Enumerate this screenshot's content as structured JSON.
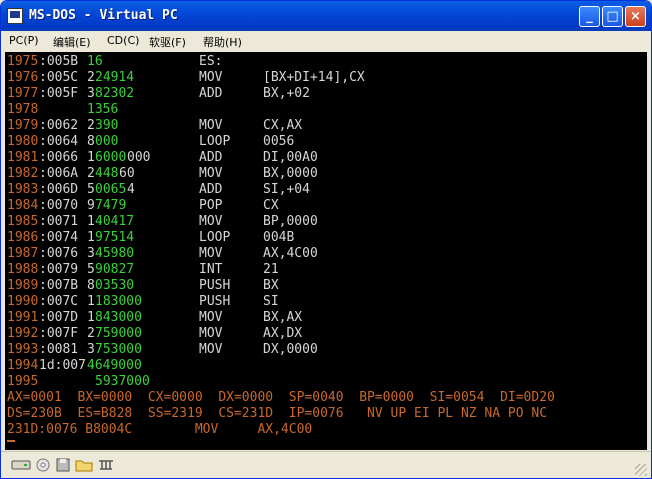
{
  "window": {
    "title": "MS-DOS - Virtual PC",
    "minimize_glyph": "_",
    "maximize_glyph": "□",
    "close_glyph": "×"
  },
  "menu": [
    {
      "label": "PC(P)"
    },
    {
      "label": "编辑(E)"
    },
    {
      "label": "CD(C)"
    },
    {
      "label": "软驱(F)"
    },
    {
      "label": "帮助(H)"
    }
  ],
  "listing": [
    {
      "n": "1975",
      "addr": ":005B",
      "ga": "",
      "val": "16",
      "vb": "",
      "mn": "ES:",
      "op": ""
    },
    {
      "n": "1976",
      "addr": ":005C",
      "ga": "2",
      "val": "24914",
      "vb": "",
      "mn": "MOV",
      "op": "[BX+DI+14],CX"
    },
    {
      "n": "1977",
      "addr": ":005F",
      "ga": "3",
      "val": "82302",
      "vb": "",
      "mn": "ADD",
      "op": "BX,+02"
    },
    {
      "n": "1978",
      "addr": "",
      "ga": "",
      "val": "1356",
      "vb": "",
      "mn": "",
      "op": ""
    },
    {
      "n": "1979",
      "addr": ":0062",
      "ga": "2",
      "val": "390",
      "vb": "",
      "mn": "MOV",
      "op": "CX,AX"
    },
    {
      "n": "1980",
      "addr": ":0064",
      "ga": "8",
      "val": "000",
      "vb": "",
      "mn": "LOOP",
      "op": "0056"
    },
    {
      "n": "1981",
      "addr": ":0066",
      "ga": "1",
      "val": "6000",
      "vb": "000",
      "mn": "ADD",
      "op": "DI,00A0"
    },
    {
      "n": "1982",
      "addr": ":006A",
      "ga": "2",
      "val": "448",
      "vb": "60",
      "mn": "MOV",
      "op": "BX,0000"
    },
    {
      "n": "1983",
      "addr": ":006D",
      "ga": "5",
      "val": "0065",
      "vb": "4",
      "mn": "ADD",
      "op": "SI,+04"
    },
    {
      "n": "1984",
      "addr": ":0070",
      "ga": "9",
      "val": "7479",
      "vb": "",
      "mn": "POP",
      "op": "CX"
    },
    {
      "n": "1985",
      "addr": ":0071",
      "ga": "1",
      "val": "40417",
      "vb": "",
      "mn": "MOV",
      "op": "BP,0000"
    },
    {
      "n": "1986",
      "addr": ":0074",
      "ga": "1",
      "val": "97514",
      "vb": "",
      "mn": "LOOP",
      "op": "004B"
    },
    {
      "n": "1987",
      "addr": ":0076",
      "ga": "3",
      "val": "45980",
      "vb": "",
      "mn": "MOV",
      "op": "AX,4C00"
    },
    {
      "n": "1988",
      "addr": ":0079",
      "ga": "5",
      "val": "90827",
      "vb": "",
      "mn": "INT",
      "op": "21"
    },
    {
      "n": "1989",
      "addr": ":007B",
      "ga": "8",
      "val": "03530",
      "vb": "",
      "mn": "PUSH",
      "op": "BX"
    },
    {
      "n": "1990",
      "addr": ":007C",
      "ga": "1",
      "val": "183000",
      "vb": "",
      "mn": "PUSH",
      "op": "SI"
    },
    {
      "n": "1991",
      "addr": ":007D",
      "ga": "1",
      "val": "843000",
      "vb": "",
      "mn": "MOV",
      "op": "BX,AX"
    },
    {
      "n": "1992",
      "addr": ":007F",
      "ga": "2",
      "val": "759000",
      "vb": "",
      "mn": "MOV",
      "op": "AX,DX"
    },
    {
      "n": "1993",
      "addr": ":0081",
      "ga": "3",
      "val": "753000",
      "vb": "",
      "mn": "MOV",
      "op": "DX,0000"
    }
  ],
  "row1994": {
    "n": "1994",
    "mid": "1d:007",
    "val": "4649000"
  },
  "row1995": {
    "n": "1995",
    "val": "5937000"
  },
  "registers": {
    "line1": "AX=0001  BX=0000  CX=0000  DX=0000  SP=0040  BP=0000  SI=0054  DI=0D20",
    "line2": "DS=230B  ES=B828  SS=2319  CS=231D  IP=0076   NV UP EI PL NZ NA PO NC",
    "line3": "231D:0076 B8004C        MOV     AX,4C00"
  },
  "statusbar": {
    "icons": [
      "hard-disk-icon",
      "cd-icon",
      "floppy-icon",
      "folder-icon",
      "network-icon"
    ]
  }
}
